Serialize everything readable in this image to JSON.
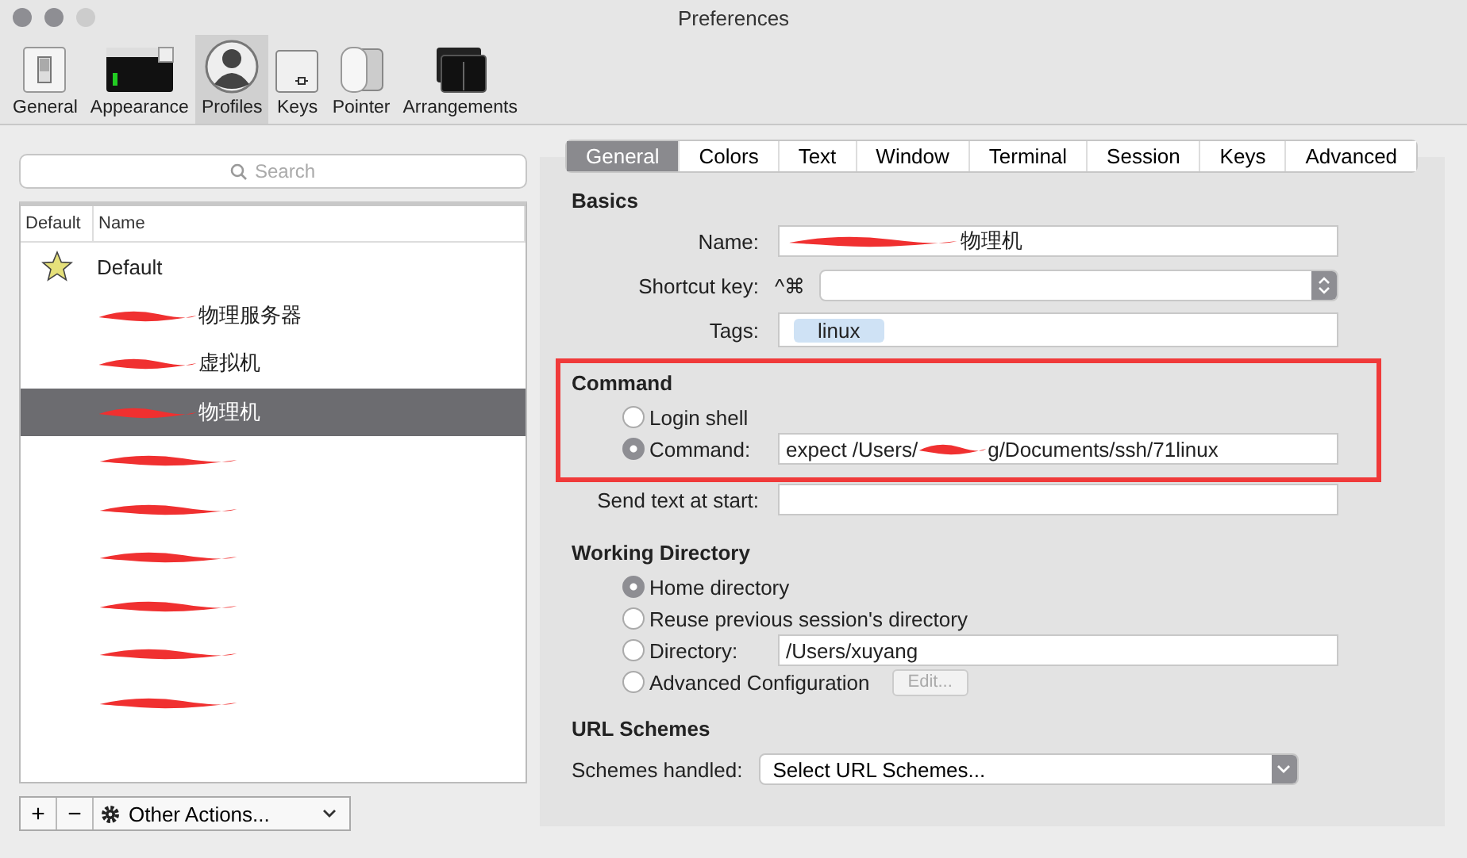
{
  "window": {
    "title": "Preferences"
  },
  "toolbar": [
    {
      "label": "General",
      "selected": false
    },
    {
      "label": "Appearance",
      "selected": false
    },
    {
      "label": "Profiles",
      "selected": true
    },
    {
      "label": "Keys",
      "selected": false
    },
    {
      "label": "Pointer",
      "selected": false
    },
    {
      "label": "Arrangements",
      "selected": false
    }
  ],
  "search": {
    "placeholder": "Search"
  },
  "profiles": {
    "columns": [
      "Default",
      "Name"
    ],
    "rows": [
      {
        "name": "Default",
        "default": true,
        "redacted": false,
        "selected": false
      },
      {
        "name": "物理服务器",
        "default": false,
        "redacted": true,
        "selected": false
      },
      {
        "name": "虚拟机",
        "default": false,
        "redacted": true,
        "selected": false
      },
      {
        "name": "物理机",
        "default": false,
        "redacted": true,
        "selected": true
      },
      {
        "default": false,
        "redacted": true,
        "selected": false
      },
      {
        "default": false,
        "redacted": true,
        "selected": false
      },
      {
        "default": false,
        "redacted": true,
        "selected": false
      },
      {
        "default": false,
        "redacted": true,
        "selected": false
      },
      {
        "default": false,
        "redacted": true,
        "selected": false
      },
      {
        "default": false,
        "redacted": true,
        "selected": false
      }
    ]
  },
  "list_buttons": [
    "+",
    "−"
  ],
  "other_actions": {
    "label": "Other Actions..."
  },
  "tabs": [
    {
      "label": "General",
      "selected": true
    },
    {
      "label": "Colors",
      "selected": false
    },
    {
      "label": "Text",
      "selected": false
    },
    {
      "label": "Window",
      "selected": false
    },
    {
      "label": "Terminal",
      "selected": false
    },
    {
      "label": "Session",
      "selected": false
    },
    {
      "label": "Keys",
      "selected": false
    },
    {
      "label": "Advanced",
      "selected": false
    }
  ],
  "basics": {
    "heading": "Basics",
    "name_label": "Name:",
    "name_value": "物理机",
    "name_redacted": true,
    "shortcut_label": "Shortcut key:",
    "shortcut_prefix": "^⌘",
    "tags_label": "Tags:",
    "tags": [
      "linux"
    ]
  },
  "command": {
    "heading": "Command",
    "highlighted": true,
    "options": [
      {
        "label": "Login shell",
        "selected": false
      },
      {
        "label": "Command:",
        "selected": true
      }
    ],
    "value_before": "expect /Users/",
    "value_redacted": true,
    "value_after": "g/Documents/ssh/71linux",
    "send_text_label": "Send text at start:"
  },
  "working_directory": {
    "heading": "Working Directory",
    "options": [
      {
        "label": "Home directory",
        "selected": true
      },
      {
        "label": "Reuse previous session's directory",
        "selected": false
      },
      {
        "label": "Directory:",
        "selected": false,
        "value": "/Users/xuyang"
      },
      {
        "label": "Advanced Configuration",
        "selected": false,
        "button": "Edit...",
        "button_disabled": true
      }
    ]
  },
  "url_schemes": {
    "heading": "URL Schemes",
    "label": "Schemes handled:",
    "value": "Select URL Schemes..."
  }
}
